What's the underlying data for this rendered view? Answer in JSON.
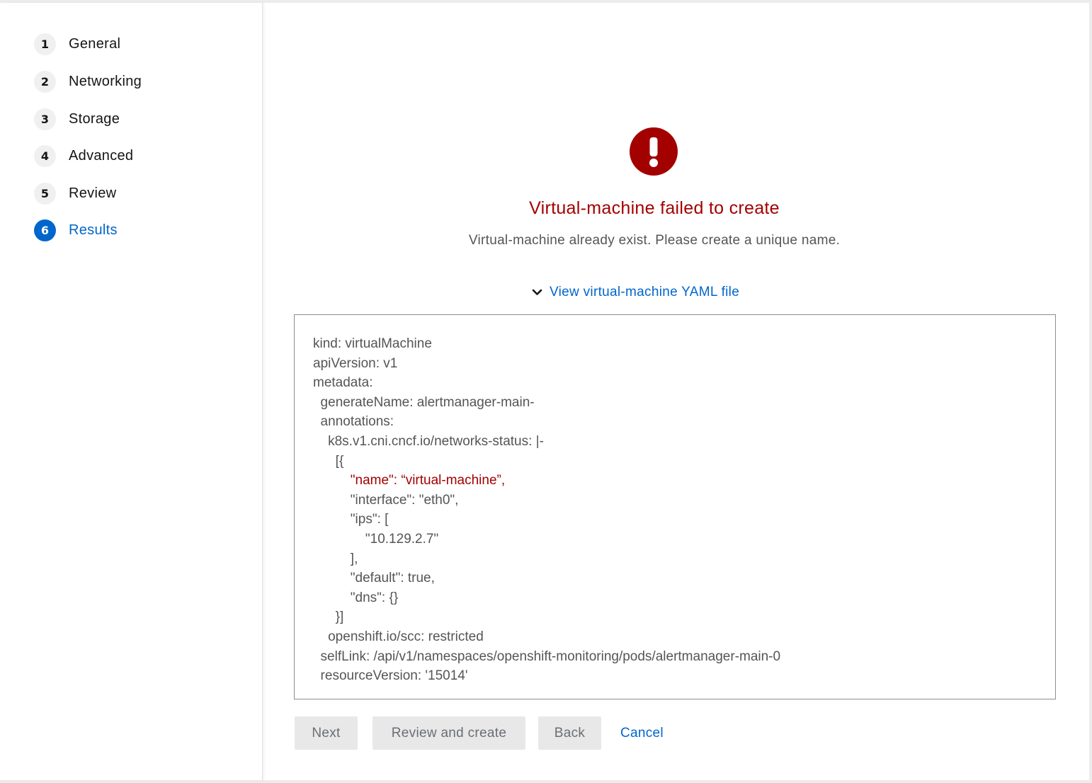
{
  "wizard_nav": {
    "steps": [
      {
        "number": "1",
        "label": "General"
      },
      {
        "number": "2",
        "label": "Networking"
      },
      {
        "number": "3",
        "label": "Storage"
      },
      {
        "number": "4",
        "label": "Advanced"
      },
      {
        "number": "5",
        "label": "Review"
      },
      {
        "number": "6",
        "label": "Results"
      }
    ],
    "active_step": "6"
  },
  "result": {
    "icon": "exclamation-circle-icon",
    "title": "Virtual-machine failed to create",
    "message": "Virtual-machine already exist. Please create a unique name.",
    "yaml_toggle_label": "View virtual-machine YAML file",
    "yaml_expanded": true
  },
  "yaml": {
    "lines": [
      "kind: virtualMachine",
      "apiVersion: v1",
      "metadata:",
      "  generateName: alertmanager-main-",
      "  annotations:",
      "    k8s.v1.cni.cncf.io/networks-status: |-",
      "      [{",
      "          \"name\": “virtual-machine”,",
      "          \"interface\": \"eth0\",",
      "          \"ips\": [",
      "              \"10.129.2.7\"",
      "          ],",
      "          \"default\": true,",
      "          \"dns\": {}",
      "      }]",
      "    openshift.io/scc: restricted",
      "  selfLink: /api/v1/namespaces/openshift-monitoring/pods/alertmanager-main-0",
      "  resourceVersion: '15014'"
    ],
    "highlighted_line": "          \"name\": “virtual-machine”,"
  },
  "footer": {
    "next_label": "Next",
    "review_label": "Review and create",
    "back_label": "Back",
    "cancel_label": "Cancel"
  },
  "colors": {
    "accent": "#0066cc",
    "danger": "#a30000",
    "disabled_bg": "#e8e8e8"
  }
}
